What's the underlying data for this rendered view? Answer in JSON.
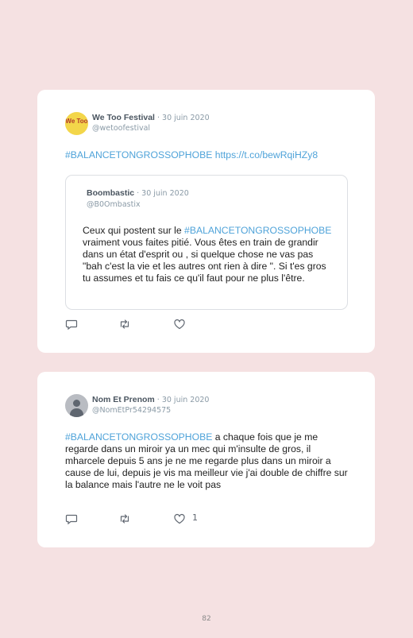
{
  "tweets": [
    {
      "name": "We Too Festival",
      "date": " · 30 juin 2020",
      "handle": "@wetoofestival",
      "avatar_text": "We Too",
      "text_tag": "#BALANCETONGROSSOPHOBE",
      "text_link": " https://t.co/bewRqiHZy8",
      "quote": {
        "name": "Boombastic",
        "date": " · 30 juin 2020",
        "handle": "@B0Ombastix",
        "text_before": "Ceux qui postent sur le ",
        "text_tag": "#BALANCETONGROSSOPHOBE",
        "text_after": " vraiment vous faites pitié. Vous êtes en train de grandir dans un état d'esprit ou , si quelque chose ne vas pas \"bah c'est la vie et les autres ont rien à dire \". Si t'es gros tu assumes et tu fais ce qu'il faut pour ne plus l'être."
      },
      "likes": ""
    },
    {
      "name": "Nom Et Prenom",
      "date": " · 30 juin 2020",
      "handle": "@NomEtPr54294575",
      "text_tag": "#BALANCETONGROSSOPHOBE",
      "text_after": " a chaque fois que je me regarde dans un miroir ya un mec qui m'insulte de gros, il mharcele depuis 5 ans je ne me regarde plus dans un miroir a cause de lui, depuis je vis ma meilleur vie j'ai double de chiffre sur la balance mais l'autre ne le voit pas",
      "likes": "1"
    }
  ],
  "icons": {
    "reply": "reply-icon",
    "retweet": "retweet-icon",
    "like": "heart-icon"
  },
  "colors": {
    "background": "#f5e1e2",
    "hashtag": "#4fa3d9",
    "card": "#ffffff"
  },
  "page_number": "82"
}
